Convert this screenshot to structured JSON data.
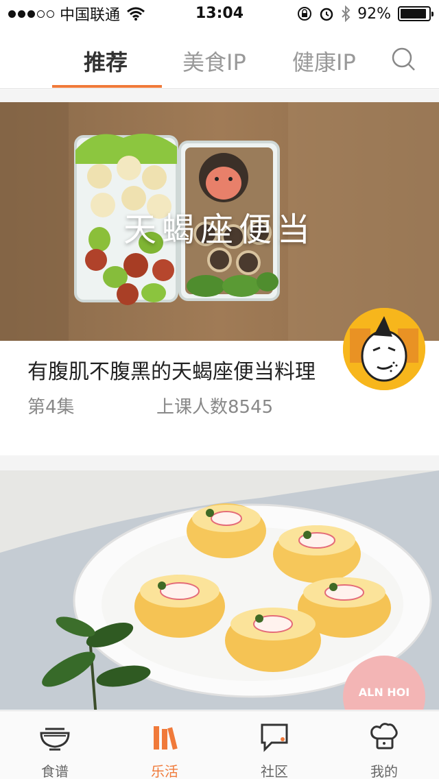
{
  "status_bar": {
    "carrier": "中国联通",
    "time": "13:04",
    "battery": "92%",
    "battery_level": 0.92,
    "signal_bars": 3
  },
  "top_tabs": [
    {
      "label": "推荐",
      "active": true
    },
    {
      "label": "美食IP",
      "active": false
    },
    {
      "label": "健康IP",
      "active": false
    }
  ],
  "icons": {
    "search": "search-icon",
    "recipe": "bowl-icon",
    "lifestyle": "books-icon",
    "community": "chat-bubble-icon",
    "profile": "chef-hat-icon"
  },
  "cards": [
    {
      "overlay": "天蝎座便当",
      "title": "有腹肌不腹黑的天蝎座便当料理",
      "episode": "第4集",
      "students": "上课人数8545"
    },
    {
      "badge_text": "ALN HOI"
    }
  ],
  "tabbar": [
    {
      "label": "食谱",
      "active": false
    },
    {
      "label": "乐活",
      "active": true
    },
    {
      "label": "社区",
      "active": false
    },
    {
      "label": "我的",
      "active": false
    }
  ],
  "colors": {
    "accent": "#f07a3a",
    "text_dark": "#222222",
    "text_muted": "#888888"
  }
}
